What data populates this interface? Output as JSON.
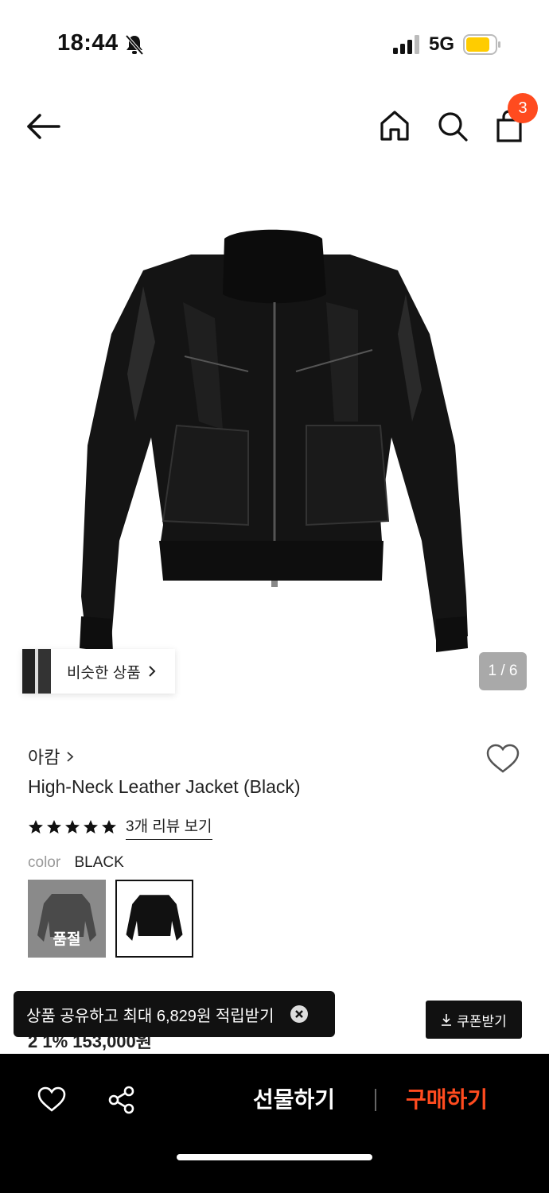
{
  "status_bar": {
    "time": "18:44",
    "network": "5G"
  },
  "nav": {
    "cart_count": "3"
  },
  "gallery": {
    "similar_label": "비슷한 상품",
    "counter": "1 / 6"
  },
  "product": {
    "brand": "아캄",
    "title": "High-Neck Leather Jacket (Black)",
    "rating_stars": 5,
    "review_link": "3개 리뷰 보기",
    "color_label": "color",
    "color_value": "BLACK",
    "swatches": [
      {
        "status": "품절"
      },
      {
        "status": ""
      }
    ],
    "price_peek": "2 1% 153,000원"
  },
  "toast": {
    "text": "상품 공유하고 최대 6,829원 적립받기"
  },
  "coupon": {
    "label": "쿠폰받기"
  },
  "bottom_bar": {
    "gift_label": "선물하기",
    "buy_label": "구매하기"
  },
  "colors": {
    "accent": "#ff4b1f",
    "battery": "#ffcc00"
  },
  "icons": [
    "bell-slash-icon",
    "signal-icon",
    "battery-icon",
    "back-arrow-icon",
    "home-icon",
    "search-icon",
    "shopping-bag-icon",
    "chevron-right-icon",
    "heart-icon",
    "star-icon",
    "close-icon",
    "download-icon",
    "share-icon"
  ]
}
